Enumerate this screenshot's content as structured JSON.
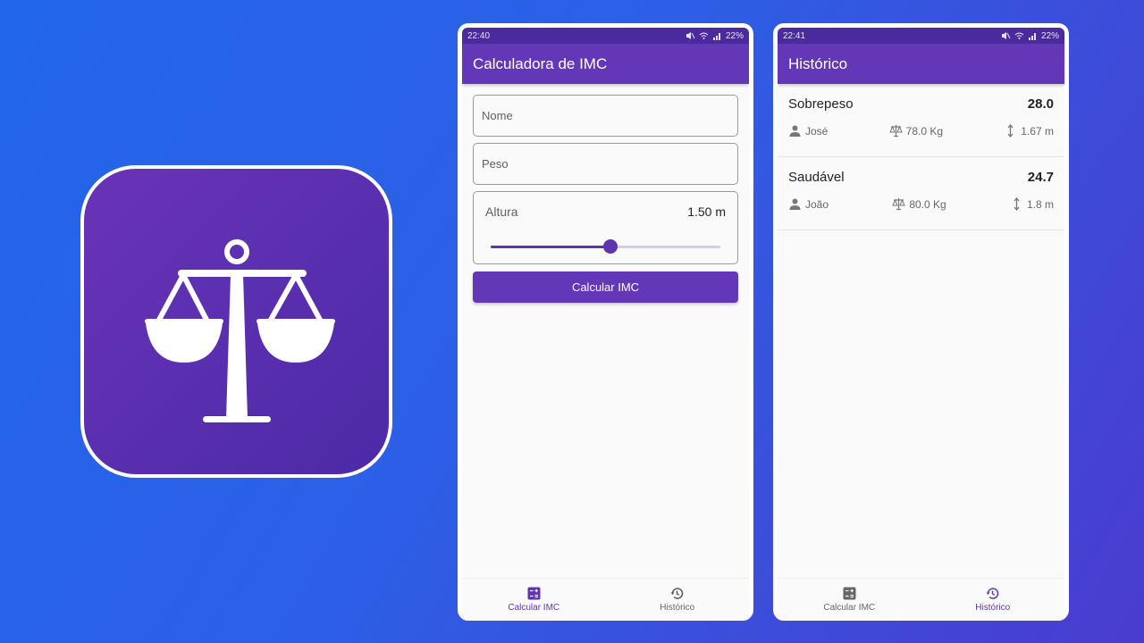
{
  "calc_screen": {
    "status_time": "22:40",
    "status_battery": "22%",
    "title": "Calculadora de IMC",
    "name_placeholder": "Nome",
    "weight_placeholder": "Peso",
    "height_label": "Altura",
    "height_value": "1.50 m",
    "slider_fraction": 0.52,
    "button_label": "Calcular IMC"
  },
  "history_screen": {
    "status_time": "22:41",
    "status_battery": "22%",
    "title": "Histórico",
    "entries": [
      {
        "category": "Sobrepeso",
        "bmi": "28.0",
        "name": "José",
        "weight": "78.0 Kg",
        "height": "1.67 m"
      },
      {
        "category": "Saudável",
        "bmi": "24.7",
        "name": "João",
        "weight": "80.0 Kg",
        "height": "1.8 m"
      }
    ]
  },
  "bottom_nav": {
    "calc_label": "Calcular IMC",
    "history_label": "Histórico"
  },
  "icons": {
    "app_icon": "balance-scale-icon",
    "nav_calc": "calculator-icon",
    "nav_history": "history-icon",
    "person": "person-icon",
    "weight": "scale-icon",
    "height": "height-arrows-icon"
  },
  "colors": {
    "primary": "#6437b9",
    "status_bar": "#4b2a9f",
    "accent": "#5e35b1"
  }
}
